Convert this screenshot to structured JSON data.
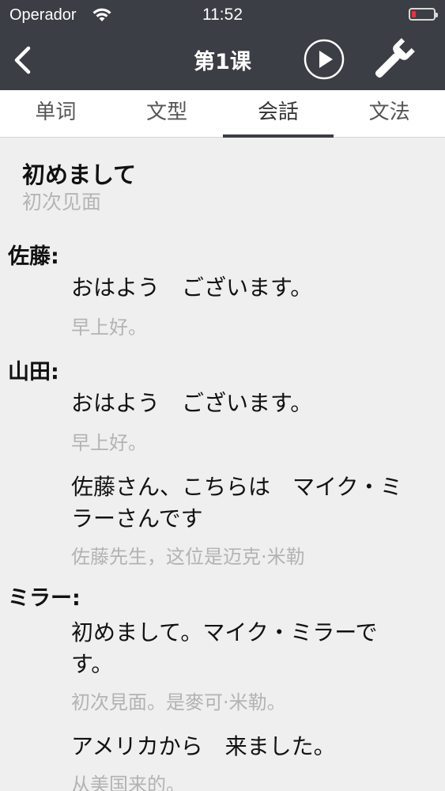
{
  "status_bar": {
    "carrier": "Operador",
    "time": "11:52",
    "battery_level": 0.2,
    "battery_color": "#ff2d2d"
  },
  "nav": {
    "title": "第1课",
    "back_icon": "chevron-left-icon",
    "play_icon": "play-icon",
    "settings_icon": "wrench-icon",
    "bar_color": "#3b3e44"
  },
  "tabs": [
    {
      "label": "单词",
      "active": false
    },
    {
      "label": "文型",
      "active": false
    },
    {
      "label": "会話",
      "active": true
    },
    {
      "label": "文法",
      "active": false
    }
  ],
  "conversation": {
    "title_jp": "初めまして",
    "title_cn": "初次见面",
    "turns": [
      {
        "speaker": "佐藤:",
        "lines": [
          {
            "jp": "おはよう　ございます。",
            "cn": "早上好。"
          }
        ]
      },
      {
        "speaker": "山田:",
        "lines": [
          {
            "jp": "おはよう　ございます。",
            "cn": "早上好。"
          },
          {
            "jp": "佐藤さん、こちらは　マイク・ミラーさんです",
            "cn": "佐藤先生，这位是迈克·米勒"
          }
        ]
      },
      {
        "speaker": "ミラー:",
        "lines": [
          {
            "jp": "初めまして。マイク・ミラーです。",
            "cn": "初次見面。是麥可·米勒。"
          },
          {
            "jp": "アメリカから　来ました。",
            "cn": "从美国来的。"
          }
        ]
      }
    ]
  }
}
